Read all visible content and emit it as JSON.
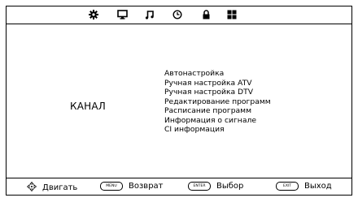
{
  "top_tabs": [
    {
      "icon": "gear-icon"
    },
    {
      "icon": "monitor-icon"
    },
    {
      "icon": "music-note-icon"
    },
    {
      "icon": "clock-icon"
    },
    {
      "icon": "lock-icon"
    },
    {
      "icon": "grid-icon"
    }
  ],
  "section": {
    "title": "КАНАЛ"
  },
  "menu": {
    "items": [
      "Автонастройка",
      "Ручная настройка ATV",
      "Ручная настройка DTV",
      "Редактирование программ",
      "Расписание программ",
      "Информация о сигнале",
      "CI информация"
    ]
  },
  "footer": {
    "move": {
      "label": "Двигать",
      "icon": "dpad-icon"
    },
    "back": {
      "key": "MENU",
      "label": "Возврат"
    },
    "select": {
      "key": "ENTER",
      "label": "Выбор"
    },
    "exit": {
      "key": "EXIT",
      "label": "Выход"
    }
  }
}
